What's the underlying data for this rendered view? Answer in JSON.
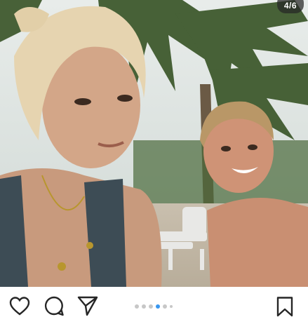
{
  "post": {
    "image_counter": "4/6",
    "photo_description_icon": "photo-selfie"
  },
  "actions": {
    "like_icon": "heart-outline-icon",
    "comment_icon": "comment-bubble-icon",
    "share_icon": "paper-plane-icon",
    "save_icon": "bookmark-icon"
  },
  "carousel": {
    "total": 6,
    "current": 4
  },
  "colors": {
    "active_dot": "#3897f0",
    "inactive_dot": "#c7c7c7",
    "icon": "#262626"
  }
}
